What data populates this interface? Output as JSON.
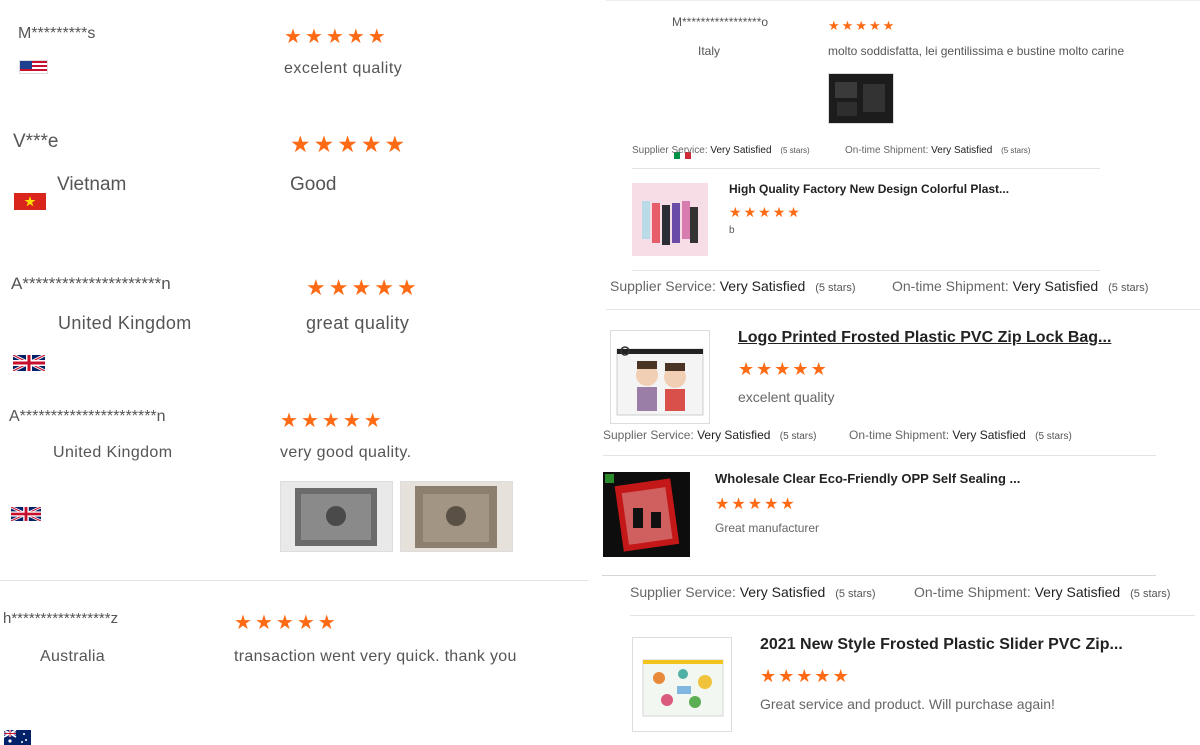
{
  "colors": {
    "star": "#ff6a14",
    "text": "#333333",
    "muted": "#666666"
  },
  "left_reviews": [
    {
      "name": "M*********s",
      "country": "",
      "flag": "us-flag-icon",
      "comment": "excelent quality"
    },
    {
      "name": "V***e",
      "country": "Vietnam",
      "flag": "vietnam-flag-icon",
      "comment": "Good"
    },
    {
      "name": "A*********************n",
      "country": "United Kingdom",
      "flag": "uk-flag-icon",
      "comment": "great quality"
    },
    {
      "name": "A**********************n",
      "country": "United Kingdom",
      "flag": "uk-flag-icon",
      "comment": "very good quality."
    },
    {
      "name": "h*****************z",
      "country": "Australia",
      "flag": "australia-flag-icon",
      "comment": "transaction went very quick. thank you"
    }
  ],
  "italy_review": {
    "name": "M*****************o",
    "country": "Italy",
    "flag": "italy-flag-icon",
    "comment": "molto soddisfatta, lei gentilissima e bustine molto carine"
  },
  "products": [
    {
      "title": "High Quality Factory New Design Colorful Plast...",
      "comment": "b"
    },
    {
      "title": "Logo Printed Frosted Plastic PVC Zip Lock Bag...",
      "comment": "excelent quality"
    },
    {
      "title": "Wholesale Clear Eco-Friendly OPP Self Sealing ...",
      "comment": "Great manufacturer"
    },
    {
      "title": "2021 New Style Frosted Plastic Slider PVC Zip...",
      "comment": "Great service and product. Will purchase again!"
    }
  ],
  "service": {
    "supplier_label": "Supplier Service:",
    "shipment_label": "On-time Shipment:",
    "value": "Very Satisfied",
    "stars_note": "(5 stars)"
  },
  "rating": {
    "stars": 5,
    "glyph": "★"
  }
}
